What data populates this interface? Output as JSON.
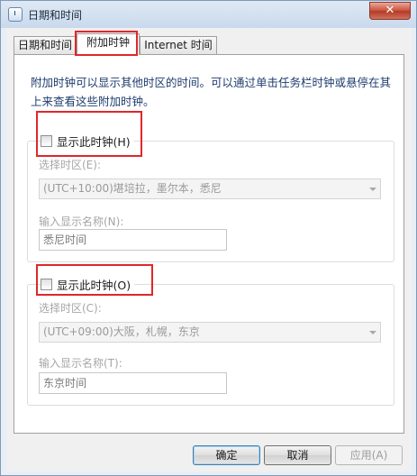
{
  "window": {
    "title": "日期和时间"
  },
  "tabs": [
    {
      "label": "日期和时间"
    },
    {
      "label": "附加时钟"
    },
    {
      "label": "Internet 时间"
    }
  ],
  "panel": {
    "description": "附加时钟可以显示其他时区的时间。可以通过单击任务栏时钟或悬停在其上来查看这些附加时钟。",
    "clock1": {
      "checkbox_label": "显示此时钟(H)",
      "checked": false,
      "timezone_label": "选择时区(E):",
      "timezone_value": "(UTC+10:00)堪培拉，墨尔本，悉尼",
      "name_label": "输入显示名称(N):",
      "name_value": "悉尼时间"
    },
    "clock2": {
      "checkbox_label": "显示此时钟(O)",
      "checked": false,
      "timezone_label": "选择时区(C):",
      "timezone_value": "(UTC+09:00)大阪，札幌，东京",
      "name_label": "输入显示名称(T):",
      "name_value": "东京时间"
    }
  },
  "buttons": {
    "ok": "确定",
    "cancel": "取消",
    "apply": "应用(A)"
  },
  "colors": {
    "highlight": "#e0272a",
    "description_text": "#1f3d6e"
  }
}
